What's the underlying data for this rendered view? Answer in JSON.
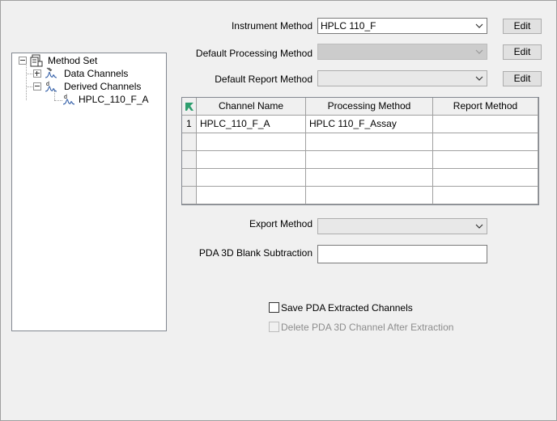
{
  "tree": {
    "root": "Method Set",
    "data_channels": "Data Channels",
    "derived_channels": "Derived Channels",
    "derived_child": "HPLC_110_F_A"
  },
  "fields": {
    "instrument_method_label": "Instrument Method",
    "instrument_method_value": "HPLC 110_F",
    "default_processing_label": "Default Processing Method",
    "default_processing_value": "",
    "default_report_label": "Default Report Method",
    "default_report_value": "",
    "edit_label": "Edit",
    "export_method_label": "Export Method",
    "export_method_value": "",
    "pda_blank_label": "PDA 3D Blank Subtraction",
    "pda_blank_value": ""
  },
  "grid": {
    "columns": [
      "Channel Name",
      "Processing Method",
      "Report Method"
    ],
    "rows": [
      {
        "num": "1",
        "channel": "HPLC_110_F_A",
        "processing": "HPLC 110_F_Assay",
        "report": ""
      },
      {
        "num": "",
        "channel": "",
        "processing": "",
        "report": ""
      },
      {
        "num": "",
        "channel": "",
        "processing": "",
        "report": ""
      },
      {
        "num": "",
        "channel": "",
        "processing": "",
        "report": ""
      },
      {
        "num": "",
        "channel": "",
        "processing": "",
        "report": ""
      }
    ]
  },
  "options": {
    "save_pda_label": "Save PDA Extracted Channels",
    "save_pda_checked": false,
    "delete_pda_label": "Delete PDA 3D Channel After Extraction",
    "delete_pda_checked": false,
    "delete_pda_enabled": false
  }
}
